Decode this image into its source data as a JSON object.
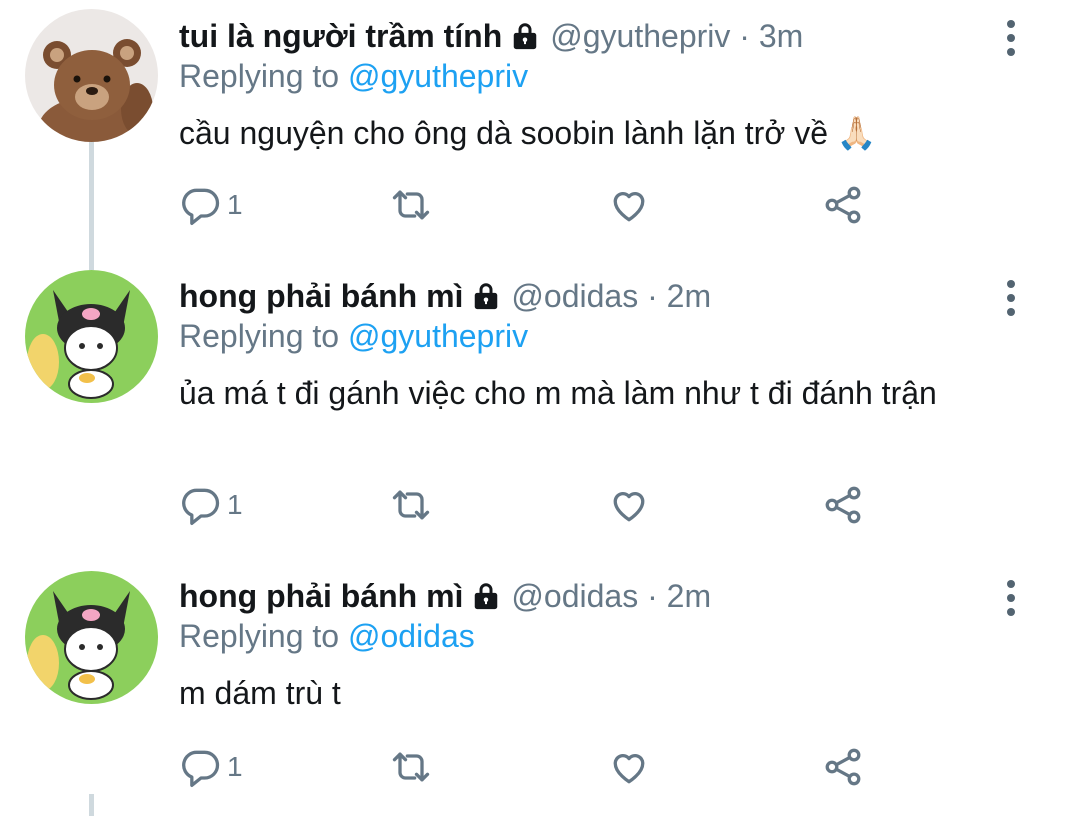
{
  "tweets": [
    {
      "name": "tui là người trầm tính",
      "handle": "@gyuthepriv",
      "separator": "·",
      "time": "3m",
      "replying_prefix": "Replying to",
      "replying_to": "@gyuthepriv",
      "text": "cầu nguyện cho ông dà soobin lành lặn trở về 🙏🏻",
      "reply_count": "1",
      "avatar": "teddy-bear"
    },
    {
      "name": "hong phải bánh mì",
      "handle": "@odidas",
      "separator": "·",
      "time": "2m",
      "replying_prefix": "Replying to",
      "replying_to": "@gyuthepriv",
      "text": "ủa má t đi gánh việc cho m mà làm như t đi đánh trận",
      "reply_count": "1",
      "avatar": "kuromi"
    },
    {
      "name": "hong phải bánh mì",
      "handle": "@odidas",
      "separator": "·",
      "time": "2m",
      "replying_prefix": "Replying to",
      "replying_to": "@odidas",
      "text": "m dám trù t",
      "reply_count": "1",
      "avatar": "kuromi"
    }
  ],
  "colors": {
    "link": "#1da1f2",
    "secondary": "#657786",
    "thread_line": "#cfd9de"
  },
  "icons": [
    "lock-icon",
    "more-options-icon",
    "reply-icon",
    "retweet-icon",
    "like-icon",
    "share-icon"
  ]
}
